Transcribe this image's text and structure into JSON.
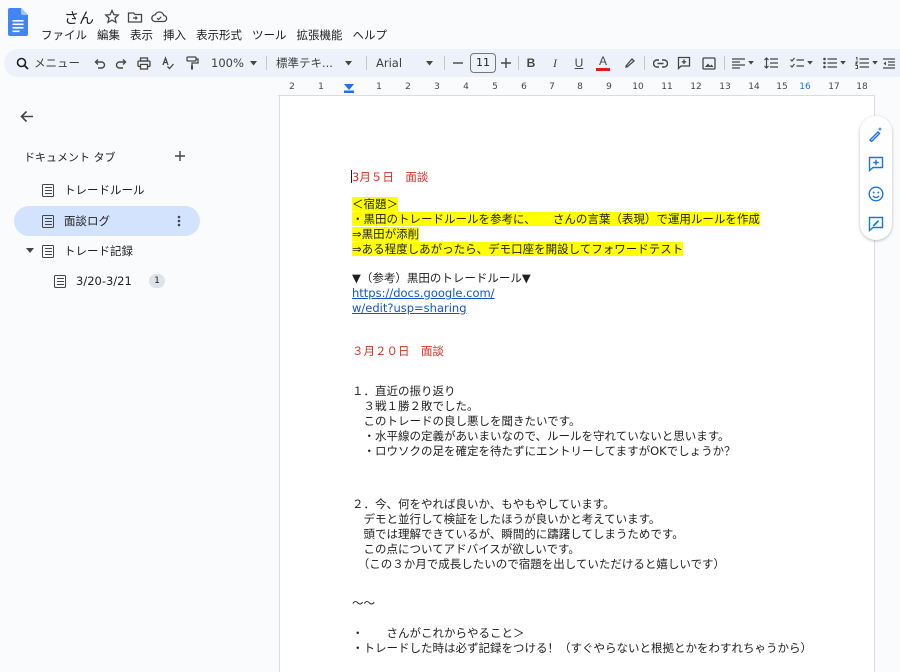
{
  "titlebar": {
    "doc_title": "さん",
    "menu": [
      "ファイル",
      "編集",
      "表示",
      "挿入",
      "表示形式",
      "ツール",
      "拡張機能",
      "ヘルプ"
    ]
  },
  "toolbar": {
    "search_label": "メニュー",
    "zoom": "100%",
    "style": "標準テキ...",
    "font": "Arial",
    "font_size": "11"
  },
  "sidebar": {
    "header": "ドキュメント タブ",
    "items": [
      {
        "label": "トレードルール"
      },
      {
        "label": "面談ログ"
      },
      {
        "label": "トレード記録"
      },
      {
        "label": "3/20-3/21",
        "badge": "1"
      }
    ]
  },
  "ruler": {
    "numbers": [
      "2",
      "1",
      "1",
      "2",
      "3",
      "4",
      "5",
      "6",
      "7",
      "8",
      "9",
      "10",
      "11",
      "12",
      "13",
      "14",
      "15",
      "16",
      "17",
      "18"
    ]
  },
  "document": {
    "lines": [
      "3月５日　面談",
      "＜宿題＞",
      "・黒田のトレードルールを参考に、　　さんの言葉（表現）で運用ルールを作成",
      "⇒黒田が添削",
      "⇒ある程度しあがったら、デモ口座を開設してフォワードテスト",
      "▼（参考）黒田のトレードルール▼",
      "https://docs.google.com/",
      "w/edit?usp=sharing",
      "３月２０日　面談",
      "１．直近の振り返り",
      "　３戦１勝２敗でした。",
      "　このトレードの良し悪しを聞きたいです。",
      "　・水平線の定義があいまいなので、ルールを守れていないと思います。",
      "　・ロウソクの足を確定を待たずにエントリーしてますがOKでしょうか？",
      "２．今、何をやれば良いか、もやもやしています。",
      "　デモと並行して検証をしたほうが良いかと考えています。",
      "　頭では理解できているが、瞬間的に躊躇してしまうためです。",
      "　この点についてアドバイスが欲しいです。",
      "　（この３か月で成長したいので宿題を出していただけると嬉しいです）",
      "〜〜",
      "・　　さんがこれからやること＞",
      "・トレードした時は必ず記録をつける！（すぐやらないと根拠とかをわすれちゃうから）"
    ]
  },
  "colors": {
    "accent": "#1a73e8",
    "selected_tab": "#d3e3fd",
    "toolbar_bg": "#edf2fa",
    "highlight": "#ffff00",
    "red_text": "#d93025",
    "link": "#1155cc"
  }
}
